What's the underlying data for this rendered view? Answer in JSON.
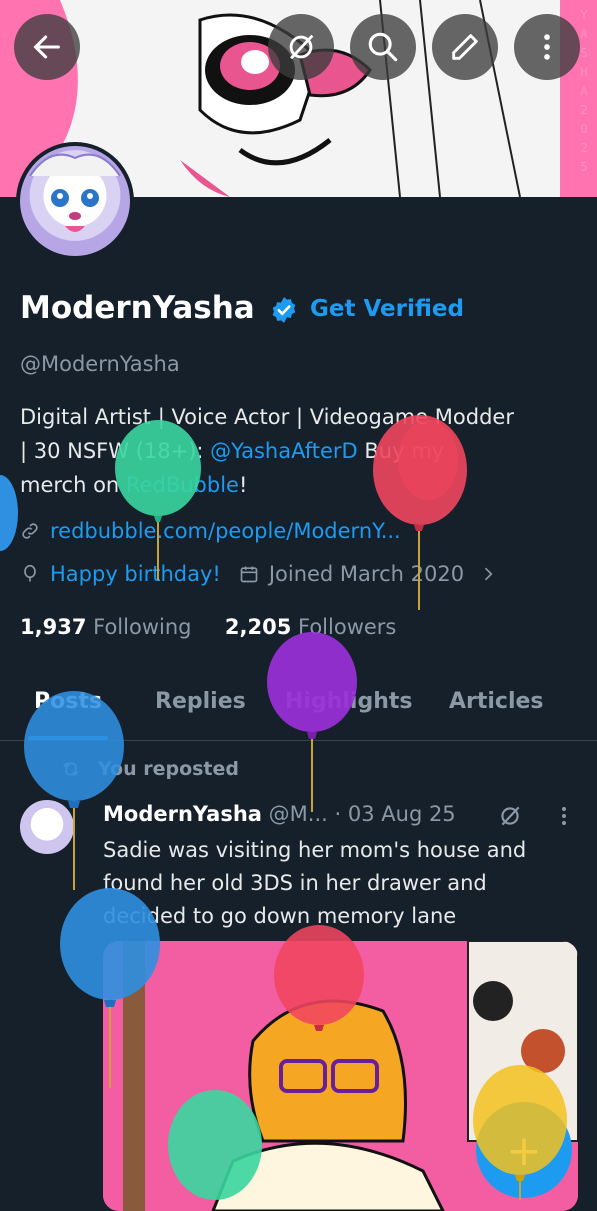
{
  "banner": {
    "side_text": "YASHA2025"
  },
  "top_actions": [
    {
      "name": "back",
      "icon": "back-arrow-icon"
    },
    {
      "name": "grok",
      "icon": "grok-icon"
    },
    {
      "name": "search",
      "icon": "search-icon"
    },
    {
      "name": "edit",
      "icon": "edit-icon"
    },
    {
      "name": "more",
      "icon": "more-vertical-icon"
    }
  ],
  "profile": {
    "name": "ModernYasha",
    "get_verified": "Get Verified",
    "handle": "@ModernYasha",
    "bio_line1": "Digital Artist | Voice Actor | Videogame Modder",
    "bio_line2_a": "| 30  NSFW (18+): ",
    "bio_mention": "@YashaAfterD",
    "bio_line2_b": "  Buy my",
    "bio_line3_a": "merch on ",
    "bio_link": "RedBubble",
    "bio_line3_b": "!",
    "website": "redbubble.com/people/ModernY...",
    "birthday": "Happy birthday!",
    "joined": "Joined March 2020",
    "following_count": "1,937",
    "following_label": "Following",
    "followers_count": "2,205",
    "followers_label": "Followers"
  },
  "tabs": [
    "Posts",
    "Replies",
    "Highlights",
    "Articles"
  ],
  "post": {
    "repost_label": "You reposted",
    "author": "ModernYasha",
    "handle": "@M...",
    "date": "· 03 Aug 25",
    "text": "Sadie was visiting her mom's house and found her old 3DS in her drawer and decided to go down memory lane"
  },
  "fab_icon": "plus-icon",
  "colors": {
    "background": "#15202b",
    "accent": "#1d9bf0",
    "banner_pink": "#ff73b0",
    "balloon_green": "#3ad6a0",
    "balloon_red": "#f0465e",
    "balloon_purple": "#9b30d9",
    "balloon_blue": "#2f8fe0",
    "balloon_yellow": "#f3c21d"
  }
}
